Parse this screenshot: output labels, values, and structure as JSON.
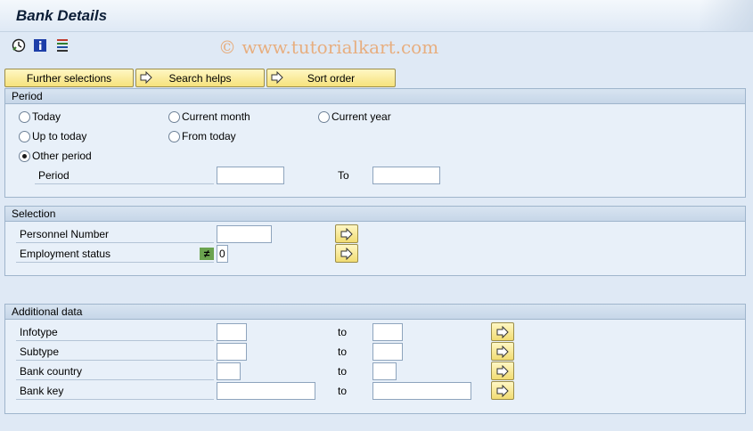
{
  "window": {
    "title": "Bank Details"
  },
  "watermark": "© www.tutorialkart.com",
  "toolbar": {
    "icons": [
      "execute-clock-icon",
      "info-icon",
      "selection-options-icon"
    ]
  },
  "buttons": {
    "further_selections": "Further selections",
    "search_helps": "Search helps",
    "sort_order": "Sort order"
  },
  "period": {
    "header": "Period",
    "today": "Today",
    "current_month": "Current month",
    "current_year": "Current year",
    "up_to_today": "Up to today",
    "from_today": "From today",
    "other_period": "Other period",
    "selected": "other_period",
    "period_label": "Period",
    "period_from": "",
    "to_label": "To",
    "period_to": ""
  },
  "selection": {
    "header": "Selection",
    "personnel_number_label": "Personnel Number",
    "personnel_number_value": "",
    "employment_status_label": "Employment status",
    "employment_status_operator": "≠",
    "employment_status_value": "0"
  },
  "additional": {
    "header": "Additional data",
    "rows": [
      {
        "label": "Infotype",
        "from": "",
        "to_label": "to",
        "to": ""
      },
      {
        "label": "Subtype",
        "from": "",
        "to_label": "to",
        "to": ""
      },
      {
        "label": "Bank country",
        "from": "",
        "to_label": "to",
        "to": ""
      },
      {
        "label": "Bank key",
        "from": "",
        "to_label": "to",
        "to": ""
      }
    ]
  }
}
